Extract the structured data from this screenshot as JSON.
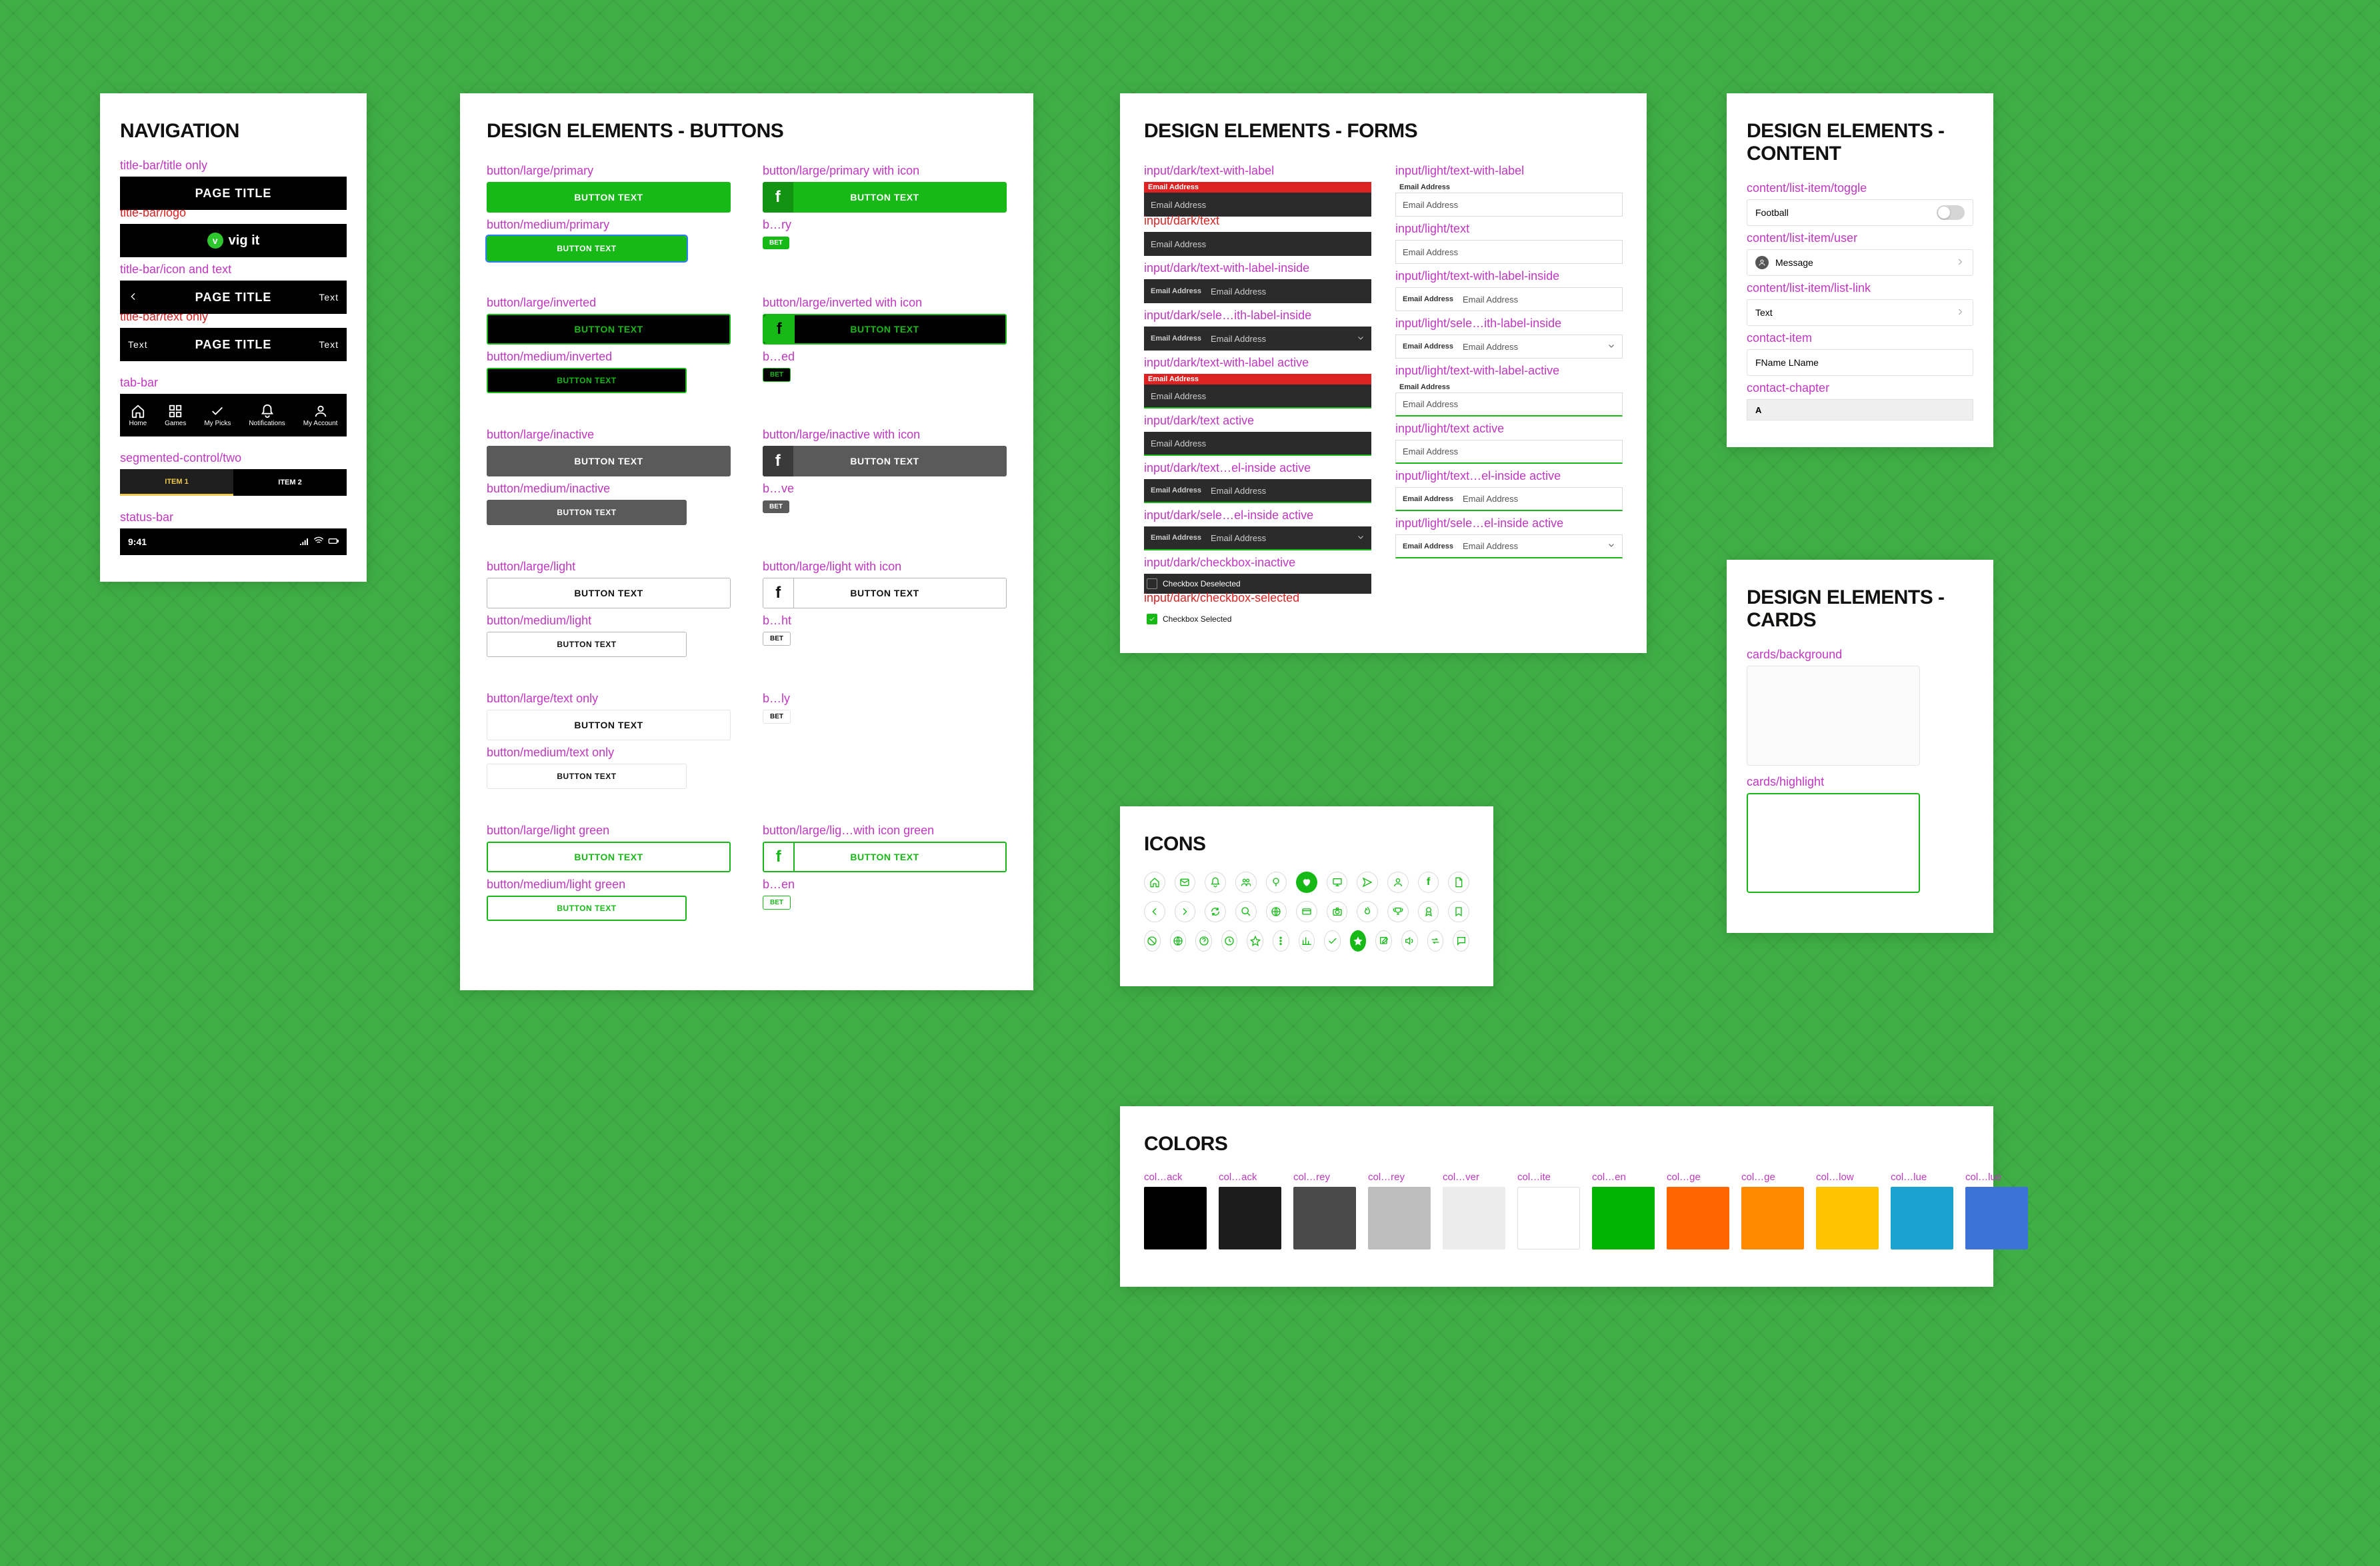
{
  "navigation": {
    "heading": "NAVIGATION",
    "title_only": {
      "label": "title-bar/title only",
      "text": "PAGE TITLE"
    },
    "logo": {
      "label": "title-bar/logo",
      "logo_letter": "v",
      "logo_text": "vig it"
    },
    "icon_text": {
      "label": "title-bar/icon and text",
      "text": "PAGE TITLE",
      "right": "Text"
    },
    "text_only": {
      "label": "title-bar/text only",
      "left": "Text",
      "text": "PAGE TITLE",
      "right": "Text"
    },
    "tabbar": {
      "label": "tab-bar",
      "items": [
        "Home",
        "Games",
        "My Picks",
        "Notifications",
        "My Account"
      ]
    },
    "segmented": {
      "label": "segmented-control/two",
      "items": [
        "ITEM 1",
        "ITEM 2"
      ]
    },
    "statusbar": {
      "label": "status-bar",
      "time": "9:41"
    }
  },
  "buttons": {
    "heading": "DESIGN ELEMENTS - BUTTONS",
    "text": "BUTTON TEXT",
    "pill": "BET",
    "rows": [
      {
        "l_caption": "button/large/primary",
        "r_caption": "button/large/primary with icon",
        "style": "primary",
        "med_caption": "button/medium/primary",
        "pill_caption": "b…ry",
        "pill": "prim",
        "selected_med": true
      },
      {
        "l_caption": "button/large/inverted",
        "r_caption": "button/large/inverted with icon",
        "style": "inverted",
        "med_caption": "button/medium/inverted",
        "pill_caption": "b…ed",
        "pill": "inv"
      },
      {
        "l_caption": "button/large/inactive",
        "r_caption": "button/large/inactive with icon",
        "style": "inactive",
        "med_caption": "button/medium/inactive",
        "pill_caption": "b…ve",
        "pill": "ina"
      },
      {
        "l_caption": "button/large/light",
        "r_caption": "button/large/light with icon",
        "style": "light",
        "med_caption": "button/medium/light",
        "pill_caption": "b…ht",
        "pill": "lig"
      },
      {
        "l_caption": "button/large/text only",
        "r_caption": "b…ly",
        "style": "textonly",
        "med_caption": "button/medium/text only",
        "pill": "txt",
        "no_icon": true
      },
      {
        "l_caption": "button/large/light green",
        "r_caption": "button/large/lig…with icon green",
        "style": "lightgreen",
        "med_caption": "button/medium/light green",
        "pill_caption": "b…en",
        "pill": "lgr"
      }
    ]
  },
  "forms": {
    "heading": "DESIGN ELEMENTS - FORMS",
    "label_text": "Email Address",
    "placeholder": "Email Address",
    "dark": {
      "text_with_label": "input/dark/text-with-label",
      "text": "input/dark/text",
      "text_label_inside": "input/dark/text-with-label-inside",
      "select_label_inside": "input/dark/sele…ith-label-inside",
      "text_with_label_active": "input/dark/text-with-label active",
      "text_active": "input/dark/text active",
      "text_label_inside_active": "input/dark/text…el-inside active",
      "select_label_inside_active": "input/dark/sele…el-inside active",
      "checkbox_inactive": "input/dark/checkbox-inactive",
      "checkbox_deselected": "Checkbox Deselected",
      "checkbox_selected_caption": "input/dark/checkbox-selected",
      "checkbox_selected": "Checkbox Selected"
    },
    "light": {
      "text_with_label": "input/light/text-with-label",
      "text": "input/light/text",
      "text_label_inside": "input/light/text-with-label-inside",
      "select_label_inside": "input/light/sele…ith-label-inside",
      "text_with_label_active": "input/light/text-with-label-active",
      "text_active": "input/light/text active",
      "text_label_inside_active": "input/light/text…el-inside active",
      "select_label_inside_active": "input/light/sele…el-inside active"
    }
  },
  "content": {
    "heading": "DESIGN ELEMENTS - CONTENT",
    "toggle": {
      "label": "content/list-item/toggle",
      "text": "Football"
    },
    "user": {
      "label": "content/list-item/user",
      "text": "Message"
    },
    "link": {
      "label": "content/list-item/list-link",
      "text": "Text"
    },
    "contact": {
      "label": "contact-item",
      "text": "FName LName"
    },
    "chapter": {
      "label": "contact-chapter",
      "text": "A"
    }
  },
  "cards": {
    "heading": "DESIGN ELEMENTS - CARDS",
    "background": "cards/background",
    "highlight": "cards/highlight"
  },
  "icons": {
    "heading": "ICONS",
    "names_row1": [
      "home",
      "mail",
      "bell",
      "people",
      "balloon",
      "heart",
      "monitor",
      "send",
      "user",
      "facebook",
      "document"
    ],
    "names_row2": [
      "chevron-left",
      "chevron-right",
      "refresh",
      "search",
      "globe",
      "card",
      "camera",
      "flame",
      "trophy",
      "ribbon",
      "bookmark"
    ],
    "names_row3": [
      "ban",
      "basketball",
      "help",
      "clock",
      "star-outline",
      "more",
      "chart",
      "check",
      "star",
      "compose",
      "volume",
      "transfer",
      "message"
    ]
  },
  "colors": {
    "heading": "COLORS",
    "swatches": [
      {
        "label": "col…ack",
        "hex": "#000000"
      },
      {
        "label": "col…ack",
        "hex": "#1C1C1C"
      },
      {
        "label": "col…rey",
        "hex": "#4A4A4A"
      },
      {
        "label": "col…rey",
        "hex": "#BDBDBD"
      },
      {
        "label": "col…ver",
        "hex": "#ECECEC"
      },
      {
        "label": "col…ite",
        "hex": "#FFFFFF"
      },
      {
        "label": "col…en",
        "hex": "#00B300"
      },
      {
        "label": "col…ge",
        "hex": "#FF6600"
      },
      {
        "label": "col…ge",
        "hex": "#FF8A00"
      },
      {
        "label": "col…low",
        "hex": "#FFC400"
      },
      {
        "label": "col…lue",
        "hex": "#1AA3D0"
      },
      {
        "label": "col…lue",
        "hex": "#3D73D6"
      }
    ]
  }
}
